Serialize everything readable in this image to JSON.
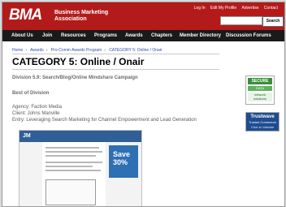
{
  "header": {
    "logo": "BMA",
    "org_line1": "Business Marketing",
    "org_line2": "Association",
    "top_links": [
      "Log In",
      "Edit My Profile",
      "Advertise",
      "Contact"
    ],
    "search_button": "Search"
  },
  "nav": [
    "About Us",
    "Join",
    "Resources",
    "Programs",
    "Awards",
    "Chapters",
    "Member Directory",
    "Discussion Forums"
  ],
  "breadcrumb": [
    "Home",
    "Awards",
    "Pro-Comm Awards Program",
    "CATEGORY 5: Online / Onair"
  ],
  "page": {
    "title": "CATEGORY 5: Online / Onair",
    "division": "Division 5.9: Search/Blog/Online Mindshare Campaign",
    "best": "Best of Division",
    "agency": "Agency: Faction Media",
    "client": "Client: Johns Manville",
    "entry": "Entry: Leveraging Search Marketing for Channel Empowerment and Lead Generation"
  },
  "screenshot": {
    "logo": "JM",
    "ad": "Save 30%"
  },
  "badges": {
    "secure_title": "SECURE",
    "secure_sub": "DATA ENCRYPTED",
    "secure_network": "network solutions",
    "trust_title": "Trustwave",
    "trust_sub": "Trusted Commerce",
    "trust_link": "Click to Validate"
  }
}
